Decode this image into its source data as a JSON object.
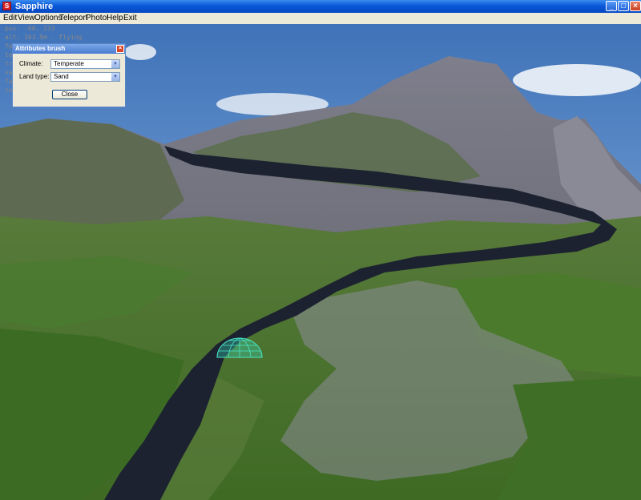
{
  "window": {
    "title": "Sapphire",
    "app_icon": "app-icon",
    "controls": {
      "minimize": "_",
      "maximize": "□",
      "close": "×"
    }
  },
  "menu": [
    "Edit",
    "View",
    "Options",
    "Teleport",
    "Photo!",
    "Help",
    "Exit"
  ],
  "hud": {
    "lines": [
      "pos: -60, 233",
      "alt: 163.9m - flying",
      "fp",
      "te",
      "tr",
      "va",
      "fa",
      "cu"
    ]
  },
  "dialog": {
    "title": "Attributes brush",
    "climate_label": "Climate:",
    "climate_value": "Temperate",
    "land_label": "Land type:",
    "land_value": "Sand",
    "close_label": "Close",
    "close_icon": "×"
  },
  "colors": {
    "sky": "#6a9ad2",
    "grass": "#4c7a2e",
    "rock": "#6e6e7a",
    "water": "#1c2230",
    "brush": "#36d8b8"
  }
}
